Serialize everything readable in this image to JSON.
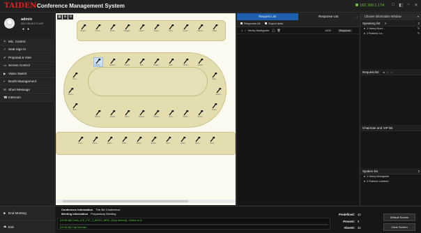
{
  "app": {
    "logo": "TAIDEN",
    "title": "Conference Management System",
    "ip": "192.168.1.174",
    "window_controls": [
      "□",
      "◧",
      "−",
      "✕"
    ]
  },
  "user": {
    "name": "admin",
    "date": "2017-06-29 17:14:57",
    "icons": [
      "user-icon",
      "power-icon"
    ]
  },
  "sidebar": {
    "items": [
      {
        "label": "Mic. Control",
        "icon": "mic-icon"
      },
      {
        "label": "Seat Sign In",
        "icon": "signin-icon"
      },
      {
        "label": "Proposal & Vote",
        "icon": "vote-icon"
      },
      {
        "label": "Screen Control",
        "icon": "screen-icon"
      },
      {
        "label": "Video Switch",
        "icon": "video-icon"
      },
      {
        "label": "Booth Management",
        "icon": "booth-icon"
      },
      {
        "label": "Short Message",
        "icon": "message-icon"
      },
      {
        "label": "Intercom",
        "icon": "phone-icon"
      }
    ],
    "end_meeting": "End Meeting",
    "exit": "Exit"
  },
  "seatmap": {
    "toolbar": [
      "grid-icon",
      "zoom-icon",
      "settings-icon"
    ],
    "top_row": [
      "Alvaro...",
      "Fiona...",
      "Brant...",
      "Maggie...",
      "Helen...",
      "Yvette...",
      "Larry...",
      "Kevin...",
      "Ciaran...",
      "Tiffan..."
    ],
    "oval_top": [
      "Henry...",
      "Robert...",
      "Bruce...",
      "Phil...",
      "Roger...",
      "Luke...",
      "Oliver...",
      "Austin..."
    ],
    "oval_left": [
      "Den...",
      "Trevor...",
      "Erik..."
    ],
    "oval_right": [
      "Stan...",
      "Anton...",
      "Vince..."
    ],
    "oval_bottom": [
      "Bernic...",
      "Angeli...",
      "Harry...",
      "Daniel...",
      "Caspe...",
      "John...",
      "Albert...",
      "Kevin..."
    ],
    "bottom_row": [
      "Leon...",
      "Steve...",
      "Justin...",
      "Jeffer...",
      "Steve...",
      "Vanha...",
      "Ivan...",
      "Heidi...",
      "Norm...",
      "Grey..."
    ]
  },
  "requests": {
    "tabs": [
      "Request List",
      "Response List"
    ],
    "toolbar": [
      "Response All",
      "Export data"
    ],
    "rows": [
      {
        "index": "1",
        "name": "Henry Montgome",
        "time": "1400",
        "tag": "Response"
      }
    ]
  },
  "right": {
    "dropdown": "Choose Information Window",
    "speaking": {
      "label": "Speaking list",
      "count": "2",
      "items": [
        "1 Henry Mont...",
        "2 Roberto La..."
      ]
    },
    "request": {
      "label": "Request list",
      "count": ""
    },
    "chairman": {
      "label": "Chairman and VIP list"
    },
    "spoken": {
      "label": "Spoken list",
      "count": "2",
      "items": [
        "1 Henry Montgome",
        "2 Roberto Lambert"
      ]
    }
  },
  "bottom": {
    "conf_info_label": "Conference information",
    "conf_info_value": "The 3th Conference",
    "meeting_info_label": "Meeting information",
    "meeting_info_value": "Preparatory Meeting",
    "log": [
      "[10:35:48]  Check_IVD_F1C_J_M1121_NEW...[Chip thermal]...Detect on 8",
      "[10:35:48]  Chip thermal..."
    ],
    "stats": [
      {
        "label": "Predefined:",
        "value": "42"
      },
      {
        "label": "Present:",
        "value": "0"
      },
      {
        "label": "Absent:",
        "value": "42"
      }
    ],
    "default_screen": "Default Screen",
    "clear_screen": "Clear Screen"
  }
}
